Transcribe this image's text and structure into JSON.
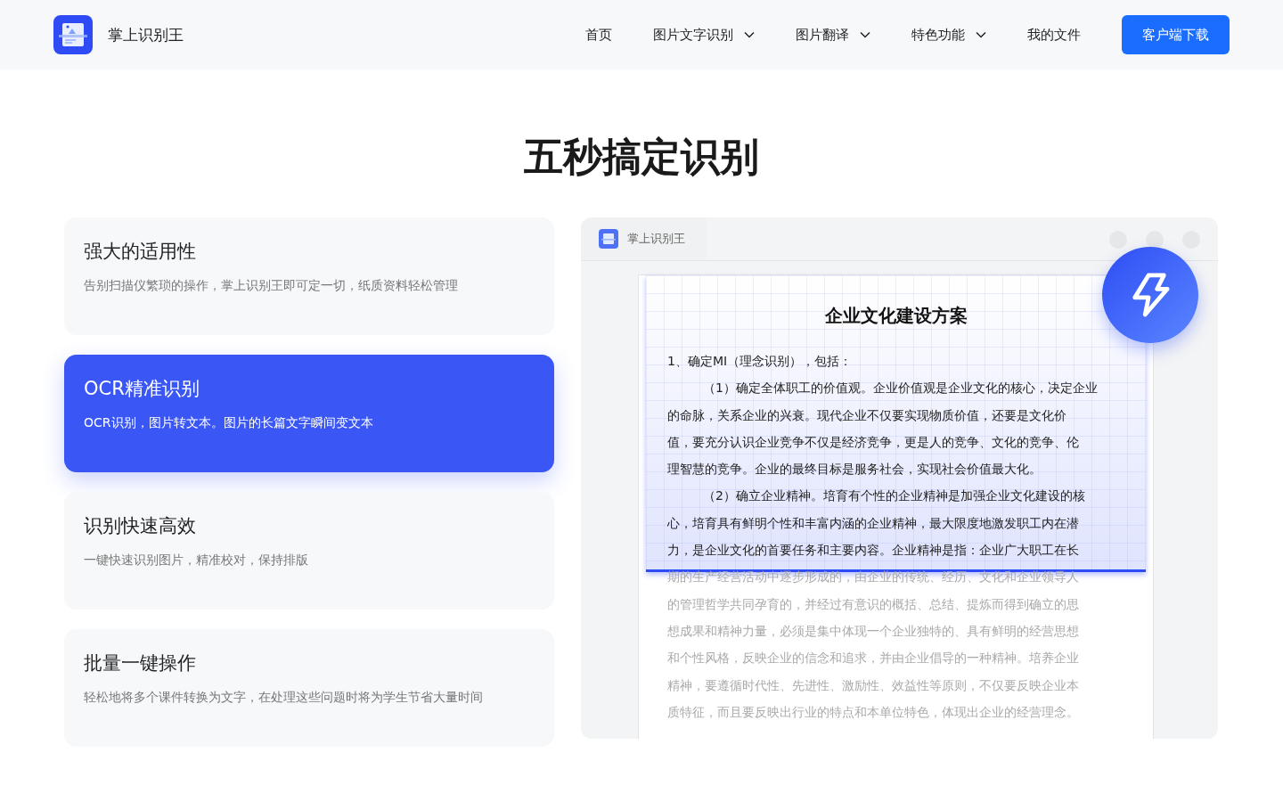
{
  "header": {
    "app_name": "掌上识别王",
    "nav": [
      {
        "label": "首页",
        "has_menu": false
      },
      {
        "label": "图片文字识别",
        "has_menu": true
      },
      {
        "label": "图片翻译",
        "has_menu": true
      },
      {
        "label": "特色功能",
        "has_menu": true
      },
      {
        "label": "我的文件",
        "has_menu": false
      }
    ],
    "download_button": "客户端下载"
  },
  "section_title": "五秒搞定识别",
  "features": [
    {
      "title": "强大的适用性",
      "description": "告别扫描仪繁琐的操作，掌上识别王即可定一切，纸质资料轻松管理",
      "selected": false
    },
    {
      "title": "OCR精准识别",
      "description": "OCR识别，图片转文本。图片的长篇文字瞬间变文本",
      "selected": true
    },
    {
      "title": "识别快速高效",
      "description": "一键快速识别图片，精准校对，保持排版",
      "selected": false
    },
    {
      "title": "批量一键操作",
      "description": "轻松地将多个课件转换为文字，在处理这些问题时将为学生节省大量时间",
      "selected": false
    }
  ],
  "preview": {
    "tab_title": "掌上识别王",
    "document": {
      "title": "企业文化建设方案",
      "lines": [
        {
          "text": "1、确定MI（理念识别），包括：",
          "indent": false,
          "scanned": true
        },
        {
          "text": "（1）确定全体职工的价值观。企业价值观是企业文化的核心，决定企业",
          "indent": true,
          "scanned": true
        },
        {
          "text": "的命脉，关系企业的兴衰。现代企业不仅要实现物质价值，还要是文化价",
          "indent": false,
          "scanned": true
        },
        {
          "text": "值，要充分认识企业竞争不仅是经济竞争，更是人的竞争、文化的竞争、伦",
          "indent": false,
          "scanned": true
        },
        {
          "text": "理智慧的竞争。企业的最终目标是服务社会，实现社会价值最大化。",
          "indent": false,
          "scanned": true
        },
        {
          "text": "（2）确立企业精神。培育有个性的企业精神是加强企业文化建设的核",
          "indent": true,
          "scanned": true
        },
        {
          "text": "心，培育具有鲜明个性和丰富内涵的企业精神，最大限度地激发职工内在潜",
          "indent": false,
          "scanned": true
        },
        {
          "text": "力，是企业文化的首要任务和主要内容。企业精神是指：企业广大职工在长",
          "indent": false,
          "scanned": true
        },
        {
          "text": "期的生产经营活动中逐步形成的，由企业的传统、经历、文化和企业领导人",
          "indent": false,
          "scanned": false
        },
        {
          "text": "的管理哲学共同孕育的，并经过有意识的概括、总结、提炼而得到确立的思",
          "indent": false,
          "scanned": false
        },
        {
          "text": "想成果和精神力量，必须是集中体现一个企业独特的、具有鲜明的经营思想",
          "indent": false,
          "scanned": false
        },
        {
          "text": "和个性风格，反映企业的信念和追求，并由企业倡导的一种精神。培养企业",
          "indent": false,
          "scanned": false
        },
        {
          "text": "精神，要遵循时代性、先进性、激励性、效益性等原则，不仅要反映企业本",
          "indent": false,
          "scanned": false
        },
        {
          "text": "质特征，而且要反映出行业的特点和本单位特色，体现出企业的经营理念。",
          "indent": false,
          "scanned": false
        }
      ]
    }
  }
}
